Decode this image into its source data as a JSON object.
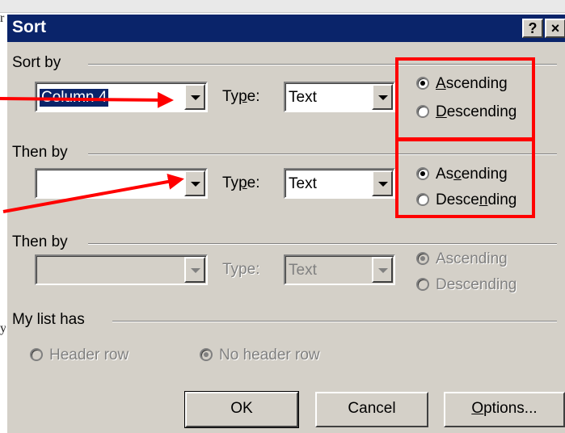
{
  "dialog": {
    "title": "Sort",
    "help_label": "?",
    "close_label": "×"
  },
  "sort_by": {
    "label": "Sort by",
    "column_value": "Column 4",
    "type_label": "Type:",
    "type_value": "Text",
    "ascending_label": "Ascending",
    "descending_label": "Descending",
    "selected": "ascending"
  },
  "then_by_1": {
    "label": "Then by",
    "column_value": "",
    "type_label": "Type:",
    "type_value": "Text",
    "ascending_label": "Ascending",
    "descending_label": "Descending",
    "selected": "ascending"
  },
  "then_by_2": {
    "label": "Then by",
    "column_value": "",
    "type_label": "Type:",
    "type_value": "Text",
    "ascending_label": "Ascending",
    "descending_label": "Descending",
    "selected": "ascending",
    "disabled": true
  },
  "list_has": {
    "label": "My list has",
    "header_row_label": "Header row",
    "no_header_row_label": "No header row",
    "selected": "no_header_row"
  },
  "buttons": {
    "ok": "OK",
    "cancel": "Cancel",
    "options": "Options..."
  },
  "annotations": {
    "color": "#ff0000"
  },
  "background_fragments": {
    "left_char_1": "r",
    "left_char_2": "y"
  }
}
